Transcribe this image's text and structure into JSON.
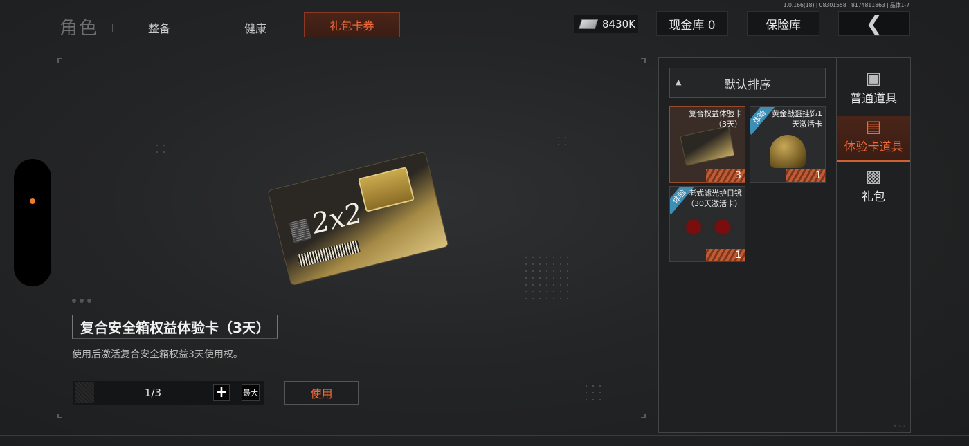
{
  "version_text": "1.0.166(18) | 08301558 | 8174811863 | 晶体1-7",
  "nav": {
    "role": "角色",
    "tabs": [
      "整备",
      "健康",
      "礼包卡券"
    ],
    "active_tab": "礼包卡券"
  },
  "header": {
    "currency_amount": "8430K",
    "cash_vault": "现金库 0",
    "safe_box": "保险库",
    "back_icon": "chevron-left-icon"
  },
  "detail": {
    "title": "复合安全箱权益体验卡（3天）",
    "description": "使用后激活复合安全箱权益3天使用权。",
    "quantity": "1/3",
    "plus_label": "+",
    "max_label": "最大",
    "use_label": "使用",
    "card_signature": "2x2"
  },
  "inventory": {
    "sort_label": "默认排序",
    "items": [
      {
        "name": "复合权益体验卡\n（3天）",
        "count": "3",
        "badge": "",
        "selected": true
      },
      {
        "name": "黄金战盔挂饰1\n天激活卡",
        "count": "1",
        "badge": "体验",
        "selected": false
      },
      {
        "name": "老式滤光护目镜\n（30天激活卡）",
        "count": "1",
        "badge": "体验",
        "selected": false
      }
    ]
  },
  "categories": [
    {
      "label": "普通道具",
      "icon": "chest-icon",
      "active": false
    },
    {
      "label": "体验卡道具",
      "icon": "card-icon",
      "active": true
    },
    {
      "label": "礼包",
      "icon": "gift-icon",
      "active": false
    }
  ],
  "colors": {
    "accent": "#f06a3a",
    "trial_badge": "#3e8fb8",
    "count_stripe": "#c25a32"
  }
}
